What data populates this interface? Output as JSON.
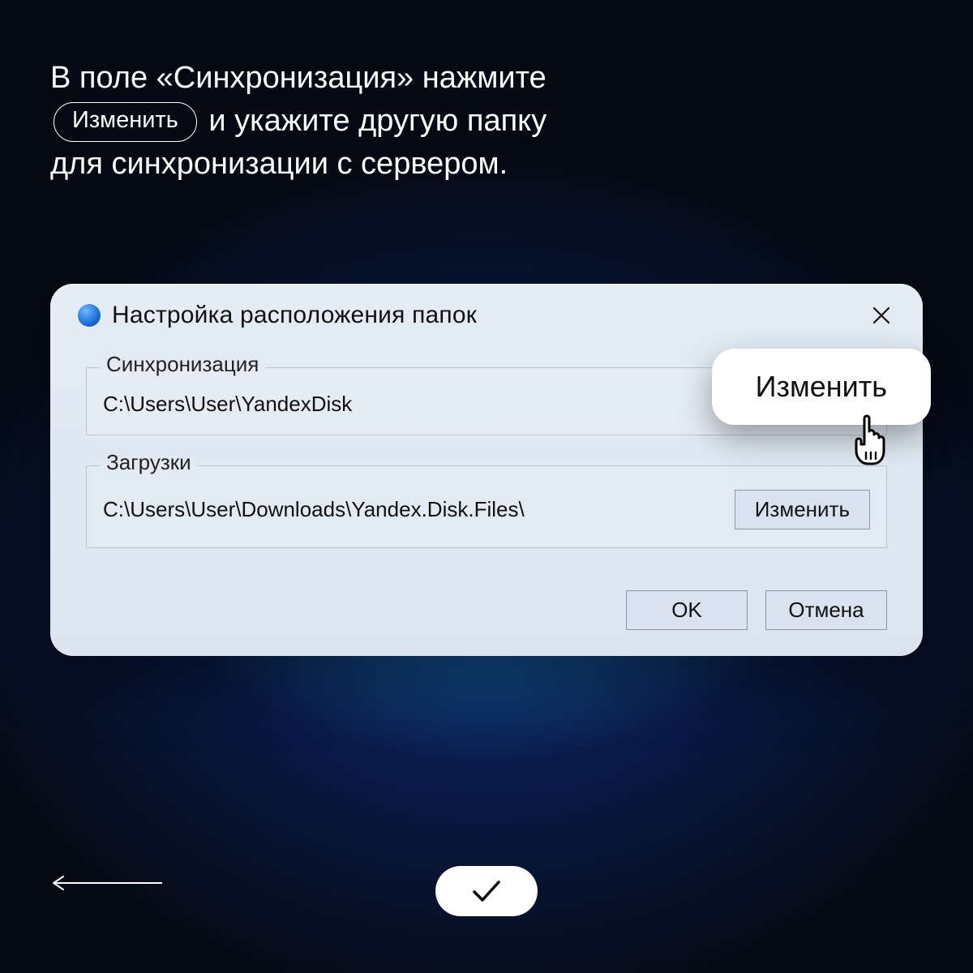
{
  "instruction": {
    "line1_before": "В поле «Синхронизация» нажмите",
    "pill_label": "Изменить",
    "line2_after": " и укажите другую папку",
    "line3": "для синхронизации с сервером."
  },
  "dialog": {
    "title": "Настройка расположения папок",
    "sync": {
      "legend": "Синхронизация",
      "path": "C:\\Users\\User\\YandexDisk",
      "change_label": "Изменить"
    },
    "downloads": {
      "legend": "Загрузки",
      "path": "C:\\Users\\User\\Downloads\\Yandex.Disk.Files\\",
      "change_label": "Изменить"
    },
    "ok_label": "OK",
    "cancel_label": "Отмена"
  }
}
